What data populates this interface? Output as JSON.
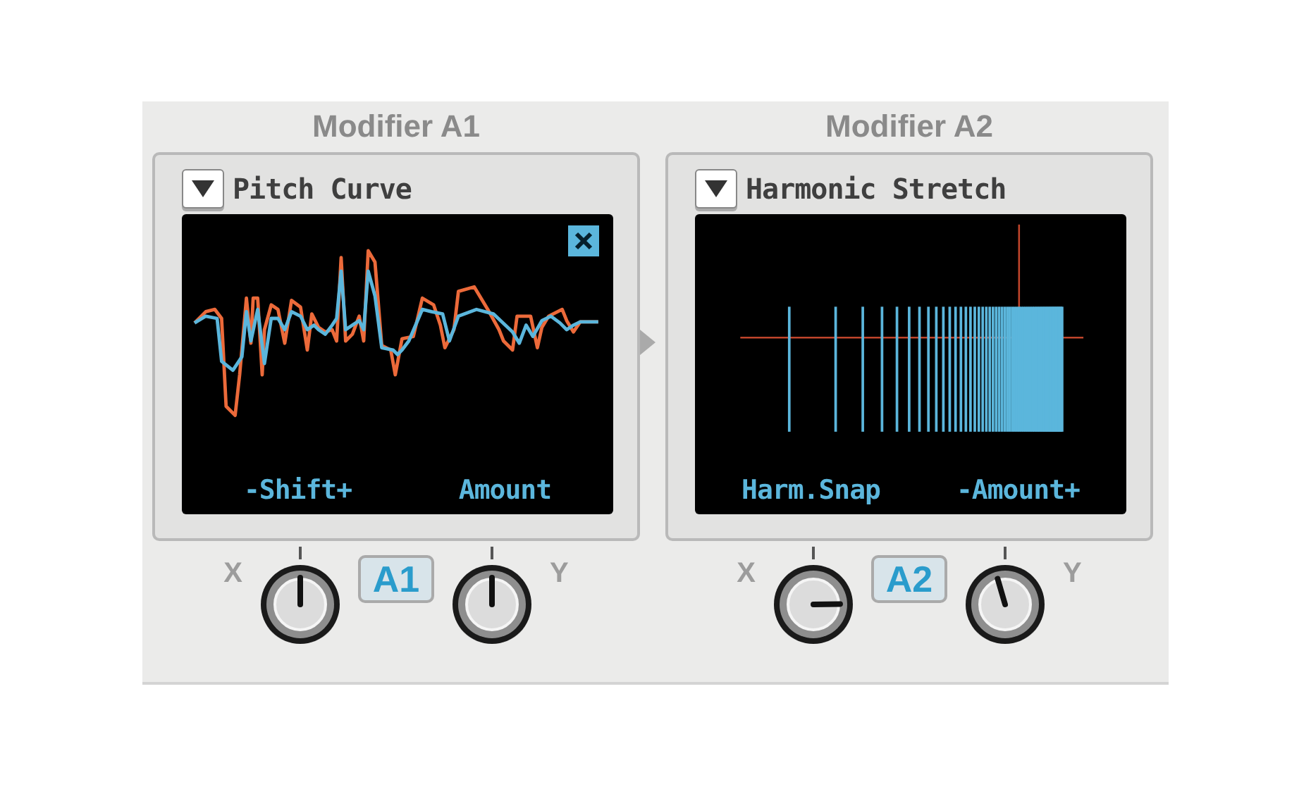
{
  "modules": [
    {
      "title": "Modifier A1",
      "mode": "Pitch Curve",
      "display": {
        "kind": "curve",
        "close_button": true,
        "labels": [
          "-Shift+",
          "Amount"
        ]
      },
      "tag": "A1",
      "knobs": [
        {
          "label": "X"
        },
        {
          "label": "Y"
        }
      ]
    },
    {
      "title": "Modifier A2",
      "mode": "Harmonic Stretch",
      "display": {
        "kind": "harmonics",
        "labels": [
          "Harm.Snap",
          "-Amount+"
        ]
      },
      "tag": "A2",
      "knobs": [
        {
          "label": "X"
        },
        {
          "label": "Y"
        }
      ]
    }
  ]
}
